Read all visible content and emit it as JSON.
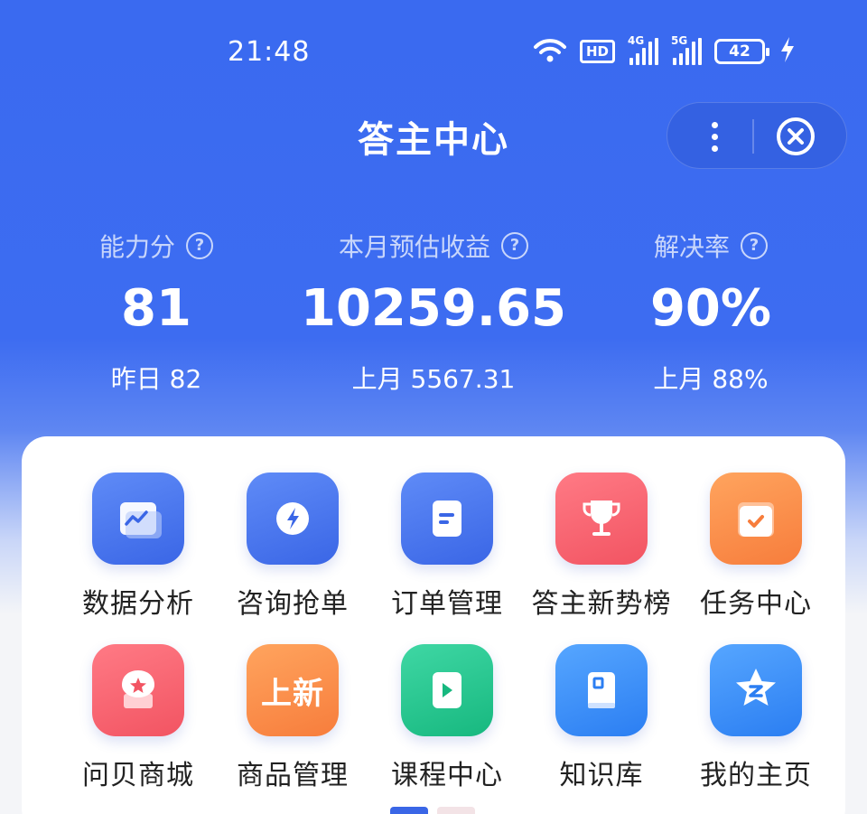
{
  "status_bar": {
    "time": "21:48",
    "hd_label": "HD",
    "net1_label": "4G",
    "net2_label": "5G",
    "battery": "42",
    "icons": [
      "wifi-icon",
      "hd-voice-icon",
      "signal-4g-icon",
      "signal-5g-icon",
      "battery-icon",
      "charging-icon"
    ]
  },
  "header": {
    "title": "答主中心",
    "more_icon": "more-vertical-icon",
    "close_icon": "close-circle-icon"
  },
  "stats": [
    {
      "label": "能力分",
      "value": "81",
      "sub": "昨日 82"
    },
    {
      "label": "本月预估收益",
      "value": "10259.65",
      "sub": "上月 5567.31"
    },
    {
      "label": "解决率",
      "value": "90%",
      "sub": "上月 88%"
    }
  ],
  "help_glyph": "?",
  "grid": {
    "row1": [
      {
        "label": "数据分析",
        "icon": "chart-icon",
        "color": "#4a77ee"
      },
      {
        "label": "咨询抢单",
        "icon": "lightning-icon",
        "color": "#4a77ee"
      },
      {
        "label": "订单管理",
        "icon": "document-icon",
        "color": "#4a77ee"
      },
      {
        "label": "答主新势榜",
        "icon": "trophy-icon",
        "color": "#f25e6b"
      },
      {
        "label": "任务中心",
        "icon": "calendar-check-icon",
        "color": "#f98a45"
      }
    ],
    "row2": [
      {
        "label": "问贝商城",
        "icon": "shell-star-icon",
        "color": "#f25e6b"
      },
      {
        "label": "商品管理",
        "icon": "new-badge-icon",
        "badge": "上新",
        "color": "#f98a45"
      },
      {
        "label": "课程中心",
        "icon": "play-icon",
        "color": "#1fc08a"
      },
      {
        "label": "知识库",
        "icon": "book-icon",
        "color": "#3386f5"
      },
      {
        "label": "我的主页",
        "icon": "star-z-icon",
        "color": "#3386f5"
      }
    ]
  },
  "pager": {
    "active_color": "#3a66e6",
    "inactive_color": "#f3e3e6"
  }
}
